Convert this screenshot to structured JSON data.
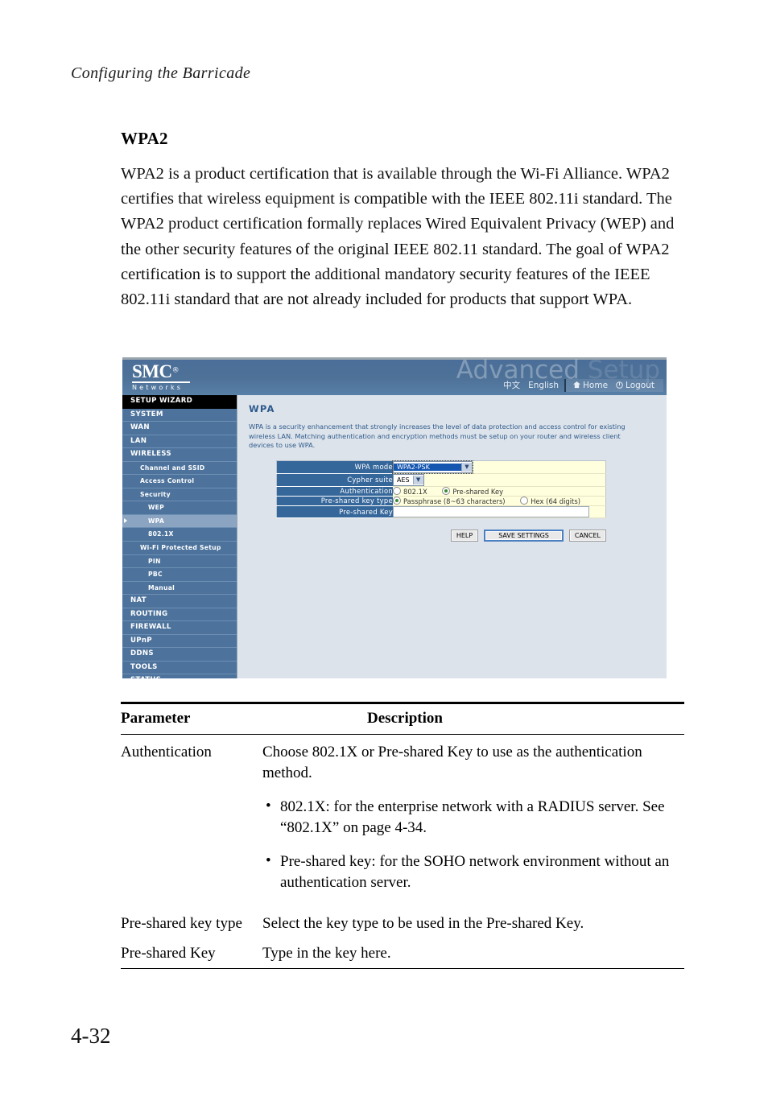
{
  "page": {
    "running_head": "Configuring the Barricade",
    "folio": "4-32"
  },
  "section": {
    "title": "WPA2",
    "paragraph": "WPA2 is a product certification that is available through the Wi-Fi Alliance. WPA2 certifies that wireless equipment is compatible with the IEEE 802.11i standard. The WPA2 product certification formally replaces Wired Equivalent Privacy (WEP) and the other security features of the original IEEE 802.11 standard. The goal of WPA2 certification is to support the additional mandatory security features of the IEEE 802.11i standard that are not already included for products that support WPA."
  },
  "screenshot": {
    "banner": {
      "logo_main": "SMC",
      "logo_reg": "®",
      "logo_sub": "Networks",
      "watermark_strong": "Advanced",
      "watermark_faded": "Setup",
      "nav": {
        "chinese": "中文",
        "english": "English",
        "home": "Home",
        "logout": "Logout"
      }
    },
    "sidebar": {
      "items": [
        {
          "label": "SETUP WIZARD",
          "level": "wizard",
          "active": false
        },
        {
          "label": "SYSTEM",
          "level": "lvl0",
          "active": false
        },
        {
          "label": "WAN",
          "level": "lvl0",
          "active": false
        },
        {
          "label": "LAN",
          "level": "lvl0",
          "active": false
        },
        {
          "label": "WIRELESS",
          "level": "lvl0",
          "active": false
        },
        {
          "label": "Channel and SSID",
          "level": "lvl1",
          "active": false
        },
        {
          "label": "Access Control",
          "level": "lvl1",
          "active": false
        },
        {
          "label": "Security",
          "level": "lvl1",
          "active": false
        },
        {
          "label": "WEP",
          "level": "lvl2",
          "active": false
        },
        {
          "label": "WPA",
          "level": "lvl2",
          "active": true
        },
        {
          "label": "802.1X",
          "level": "lvl2",
          "active": false
        },
        {
          "label": "Wi-Fi Protected Setup",
          "level": "lvl1",
          "active": false
        },
        {
          "label": "PIN",
          "level": "lvl2",
          "active": false
        },
        {
          "label": "PBC",
          "level": "lvl2",
          "active": false
        },
        {
          "label": "Manual",
          "level": "lvl2",
          "active": false
        },
        {
          "label": "NAT",
          "level": "lvl0",
          "active": false
        },
        {
          "label": "ROUTING",
          "level": "lvl0",
          "active": false
        },
        {
          "label": "FIREWALL",
          "level": "lvl0",
          "active": false
        },
        {
          "label": "UPnP",
          "level": "lvl0",
          "active": false
        },
        {
          "label": "DDNS",
          "level": "lvl0",
          "active": false
        },
        {
          "label": "TOOLS",
          "level": "lvl0",
          "active": false
        },
        {
          "label": "STATUS",
          "level": "lvl0",
          "active": false
        }
      ]
    },
    "panel": {
      "title": "WPA",
      "description": "WPA is a security enhancement that strongly increases the level of data protection and access control for existing wireless LAN. Matching authentication and encryption methods must be setup on your router and wireless client devices to use WPA.",
      "fields": {
        "wpa_mode_label": "WPA mode",
        "wpa_mode_value": "WPA2-PSK",
        "cypher_suite_label": "Cypher suite",
        "cypher_suite_value": "AES",
        "authentication_label": "Authentication",
        "auth_option_8021x": "802.1X",
        "auth_option_psk": "Pre-shared Key",
        "psk_type_label": "Pre-shared key type",
        "psk_type_passphrase": "Passphrase (8~63 characters)",
        "psk_type_hex": "Hex (64 digits)",
        "psk_label": "Pre-shared Key",
        "psk_value": ""
      },
      "buttons": {
        "help": "HELP",
        "save": "SAVE SETTINGS",
        "cancel": "CANCEL"
      }
    },
    "colors": {
      "banner_blue": "#4e7198",
      "sidebar_blue": "#4d739c",
      "sidebar_active": "#8ba4c2",
      "content_bg": "#dde3ea",
      "form_label_blue": "#36679b",
      "form_value_bg": "#ffffdd",
      "panel_text_blue": "#2e5b8d"
    }
  },
  "param_table": {
    "header": {
      "parameter": "Parameter",
      "description": "Description"
    },
    "rows": [
      {
        "parameter": "Authentication",
        "description": "Choose 802.1X or Pre-shared Key to use as the authentication method.",
        "bullets": [
          "802.1X: for the enterprise network with a RADIUS server. See “802.1X” on page 4-34.",
          "Pre-shared key: for the SOHO network environment without an authentication server."
        ]
      },
      {
        "parameter": "Pre-shared key type",
        "description": "Select the key type to be used in the Pre-shared Key.",
        "bullets": []
      },
      {
        "parameter": "Pre-shared Key",
        "description": "Type in the key here.",
        "bullets": []
      }
    ]
  }
}
